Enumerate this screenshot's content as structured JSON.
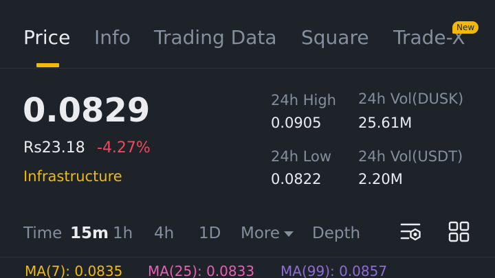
{
  "tabs": [
    {
      "label": "Price",
      "active": true
    },
    {
      "label": "Info"
    },
    {
      "label": "Trading Data"
    },
    {
      "label": "Square"
    },
    {
      "label": "Trade-X",
      "badge": "New"
    }
  ],
  "price": {
    "last": "0.0829",
    "fiat": "Rs23.18",
    "change": "-4.27%",
    "category": "Infrastructure"
  },
  "stats": {
    "high_label": "24h High",
    "high_value": "0.0905",
    "vol_base_label": "24h Vol(DUSK)",
    "vol_base_value": "25.61M",
    "low_label": "24h Low",
    "low_value": "0.0822",
    "vol_quote_label": "24h Vol(USDT)",
    "vol_quote_value": "2.20M"
  },
  "timebar": {
    "time_label": "Time",
    "intervals": [
      "15m",
      "1h",
      "4h",
      "1D"
    ],
    "active_interval": "15m",
    "more_label": "More",
    "depth_label": "Depth"
  },
  "ma": {
    "ma7": "MA(7): 0.0835",
    "ma25": "MA(25): 0.0833",
    "ma99": "MA(99): 0.0857",
    "ma7_color": "#f0b90b",
    "ma25_color": "#e85fb4",
    "ma99_color": "#8f6bd8"
  },
  "colors": {
    "background": "#1e2329",
    "accent": "#f0b90b",
    "down": "#f6465d",
    "muted": "#848e9c"
  },
  "icons": [
    "indicator-settings-icon",
    "grid-layout-icon"
  ]
}
